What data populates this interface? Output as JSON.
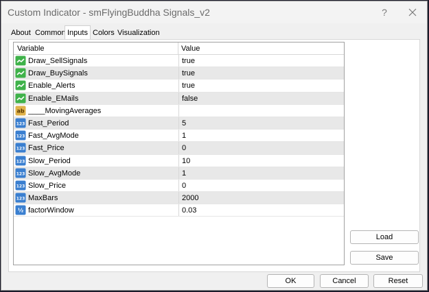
{
  "window": {
    "title": "Custom Indicator - smFlyingBuddha Signals_v2",
    "help_label": "?"
  },
  "tabs": [
    {
      "label": "About"
    },
    {
      "label": "Common"
    },
    {
      "label": "Inputs"
    },
    {
      "label": "Colors"
    },
    {
      "label": "Visualization"
    }
  ],
  "active_tab": "Inputs",
  "grid": {
    "columns": {
      "variable": "Variable",
      "value": "Value"
    },
    "rows": [
      {
        "icon": "bool-icon",
        "name": "Draw_SellSignals",
        "value": "true"
      },
      {
        "icon": "bool-icon",
        "name": "Draw_BuySignals",
        "value": "true"
      },
      {
        "icon": "bool-icon",
        "name": "Enable_Alerts",
        "value": "true"
      },
      {
        "icon": "bool-icon",
        "name": "Enable_EMails",
        "value": "false"
      },
      {
        "icon": "string-icon",
        "name": "____MovingAverages",
        "value": ""
      },
      {
        "icon": "integer-icon",
        "name": "Fast_Period",
        "value": "5"
      },
      {
        "icon": "integer-icon",
        "name": "Fast_AvgMode",
        "value": "1"
      },
      {
        "icon": "integer-icon",
        "name": "Fast_Price",
        "value": "0"
      },
      {
        "icon": "integer-icon",
        "name": "Slow_Period",
        "value": "10"
      },
      {
        "icon": "integer-icon",
        "name": "Slow_AvgMode",
        "value": "1"
      },
      {
        "icon": "integer-icon",
        "name": "Slow_Price",
        "value": "0"
      },
      {
        "icon": "integer-icon",
        "name": "MaxBars",
        "value": "2000"
      },
      {
        "icon": "double-icon",
        "name": "factorWindow",
        "value": "0.03"
      }
    ]
  },
  "buttons": {
    "load": "Load",
    "save": "Save",
    "ok": "OK",
    "cancel": "Cancel",
    "reset": "Reset"
  },
  "colors": {
    "bool_icon": "#3fb24a",
    "string_icon": "#e0b24a",
    "integer_icon": "#3a7fd0",
    "alt_row": "#e8e8e8"
  },
  "icon_glyphs": {
    "string-icon": "ab",
    "integer-icon": "123",
    "double-icon": "½"
  }
}
